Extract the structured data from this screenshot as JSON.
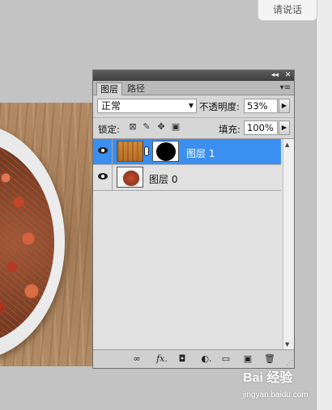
{
  "page": {
    "comment_button": "请说话"
  },
  "panel": {
    "titlebar": {
      "collapse_glyph": "◂◂",
      "close_glyph": "✕"
    },
    "tabs": [
      {
        "label": "图层",
        "active": true
      },
      {
        "label": "路径",
        "active": false
      }
    ],
    "menu_glyph": "▾≡",
    "blend_mode": "正常",
    "opacity_label": "不透明度:",
    "opacity_value": "53%",
    "lock_label": "锁定:",
    "lock_icons": [
      "transparency-lock-icon",
      "brush-lock-icon",
      "move-lock-icon",
      "padlock-icon"
    ],
    "fill_label": "填充:",
    "fill_value": "100%",
    "layers": [
      {
        "name": "图层 1",
        "selected": true,
        "visible": true,
        "has_mask": true
      },
      {
        "name": "图层 0",
        "selected": false,
        "visible": true,
        "has_mask": false
      }
    ],
    "bottom_icons": [
      "link-layers-icon",
      "fx-icon",
      "add-mask-icon",
      "adjustment-layer-icon",
      "new-group-icon",
      "new-layer-icon",
      "delete-icon"
    ],
    "bottom_glyphs": {
      "link": "∞",
      "fx": "fx.",
      "mask": "◘",
      "adjust": "◐.",
      "group": "▭",
      "new": "▣",
      "delete": "🗑"
    }
  },
  "watermark": {
    "line1": "Bai 经验",
    "line2": "jingyan.baidu.com"
  }
}
